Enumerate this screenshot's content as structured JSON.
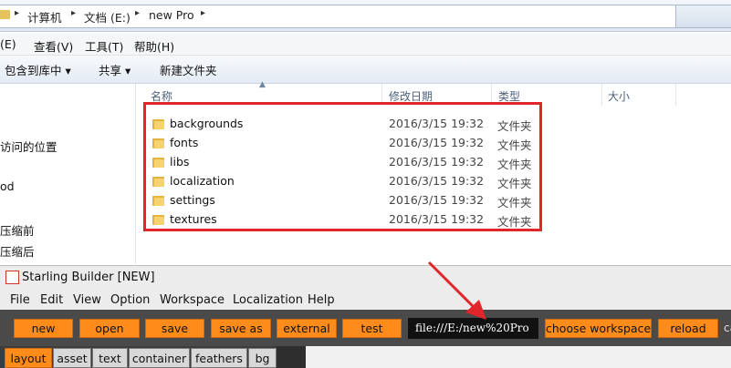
{
  "explorer": {
    "breadcrumb": [
      "计算机",
      "文档 (E:)",
      "new Pro"
    ],
    "menu": [
      "(E)",
      "查看(V)",
      "工具(T)",
      "帮助(H)"
    ],
    "toolbar": [
      "包含到库中 ▾",
      "共享 ▾",
      "新建文件夹"
    ],
    "nav": [
      "访问的位置",
      "od",
      "压缩前",
      "压缩后"
    ],
    "columns": {
      "name": "名称",
      "date": "修改日期",
      "type": "类型",
      "size": "大小"
    },
    "files": [
      {
        "name": "backgrounds",
        "date": "2016/3/15 19:32",
        "type": "文件夹"
      },
      {
        "name": "fonts",
        "date": "2016/3/15 19:32",
        "type": "文件夹"
      },
      {
        "name": "libs",
        "date": "2016/3/15 19:32",
        "type": "文件夹"
      },
      {
        "name": "localization",
        "date": "2016/3/15 19:32",
        "type": "文件夹"
      },
      {
        "name": "settings",
        "date": "2016/3/15 19:32",
        "type": "文件夹"
      },
      {
        "name": "textures",
        "date": "2016/3/15 19:32",
        "type": "文件夹"
      }
    ]
  },
  "starling": {
    "title": "Starling Builder [NEW]",
    "menu": [
      "File",
      "Edit",
      "View",
      "Option",
      "Workspace",
      "Localization",
      "Help"
    ],
    "buttons": [
      "new",
      "open",
      "save",
      "save as",
      "external",
      "test",
      "choose workspace",
      "reload"
    ],
    "path": "file:///E:/new%20Pro",
    "cut_text": "ca",
    "tabs": [
      "layout",
      "asset",
      "text",
      "container",
      "feathers",
      "bg"
    ]
  },
  "colors": {
    "accent": "#ff8c1a",
    "highlight": "#e0262b"
  }
}
